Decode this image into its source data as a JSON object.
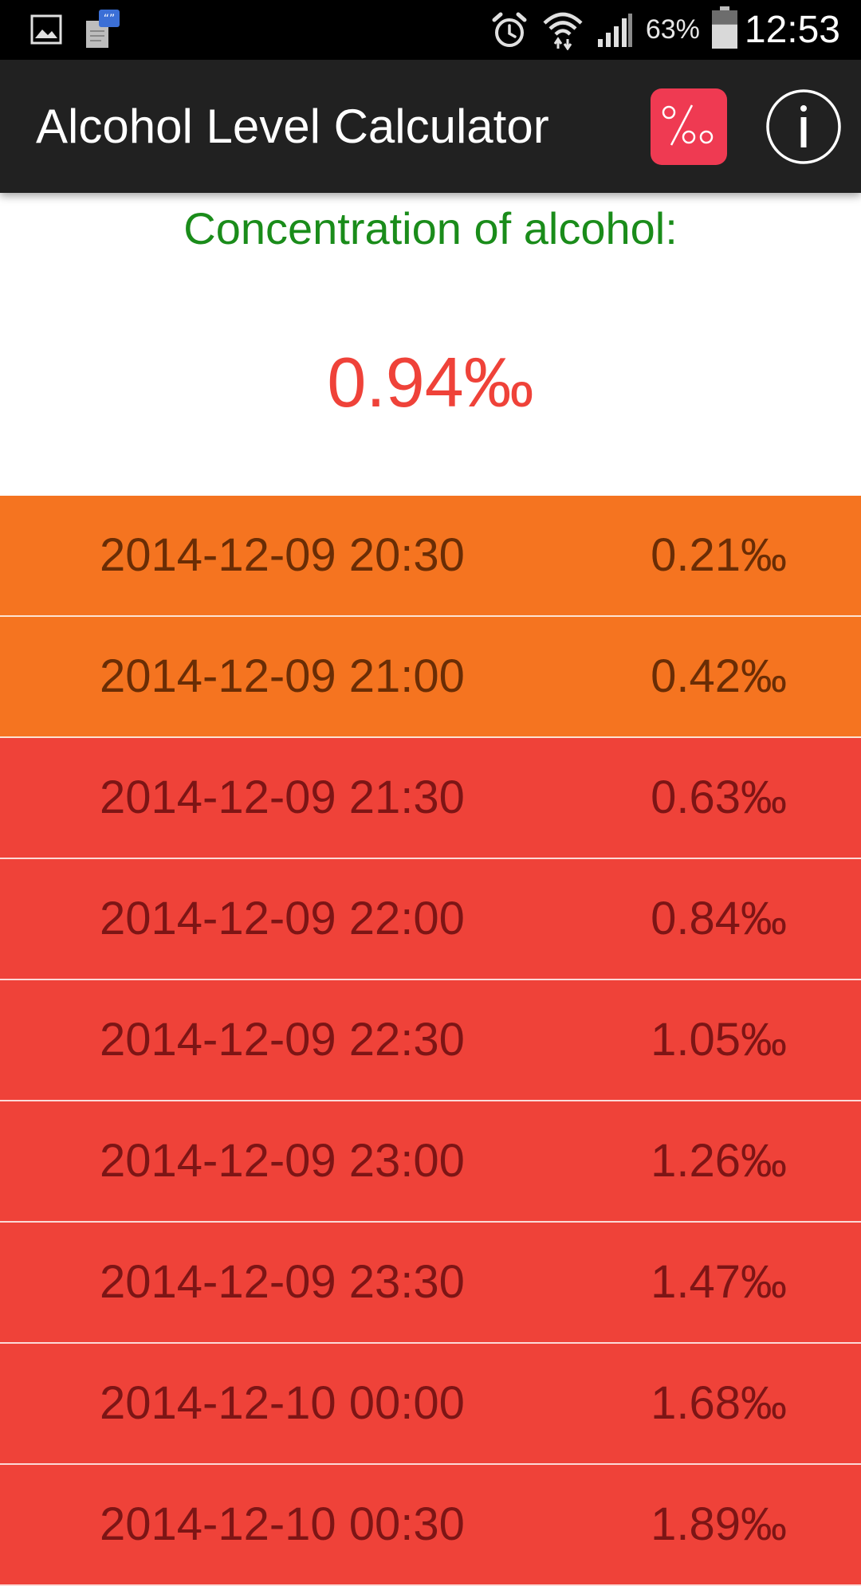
{
  "status_bar": {
    "icons_left": [
      "gallery-icon",
      "message-notification-icon"
    ],
    "icons_right": [
      "alarm-icon",
      "wifi-icon",
      "signal-icon"
    ],
    "battery_percent": "63%",
    "battery_level": 0.63,
    "time": "12:53"
  },
  "action_bar": {
    "title": "Alcohol Level Calculator",
    "actions": [
      "permille-icon",
      "info-icon"
    ]
  },
  "main": {
    "concentration_label": "Concentration of alcohol:",
    "concentration_value": "0.94‰"
  },
  "colors": {
    "status_bar_bg": "#000000",
    "action_bar_bg": "#212121",
    "label_green": "#1a8c1a",
    "value_red": "#ef4239",
    "permille_button": "#ef3a52",
    "row_orange": "#f57420",
    "row_red": "#ef4239",
    "row_text_orange": "#6a2d05",
    "row_text_red": "#7d1515"
  },
  "history": [
    {
      "time": "2014-12-09 20:30",
      "level": "0.21‰",
      "status": "orange"
    },
    {
      "time": "2014-12-09 21:00",
      "level": "0.42‰",
      "status": "orange"
    },
    {
      "time": "2014-12-09 21:30",
      "level": "0.63‰",
      "status": "red"
    },
    {
      "time": "2014-12-09 22:00",
      "level": "0.84‰",
      "status": "red"
    },
    {
      "time": "2014-12-09 22:30",
      "level": "1.05‰",
      "status": "red"
    },
    {
      "time": "2014-12-09 23:00",
      "level": "1.26‰",
      "status": "red"
    },
    {
      "time": "2014-12-09 23:30",
      "level": "1.47‰",
      "status": "red"
    },
    {
      "time": "2014-12-10 00:00",
      "level": "1.68‰",
      "status": "red"
    },
    {
      "time": "2014-12-10 00:30",
      "level": "1.89‰",
      "status": "red"
    }
  ]
}
